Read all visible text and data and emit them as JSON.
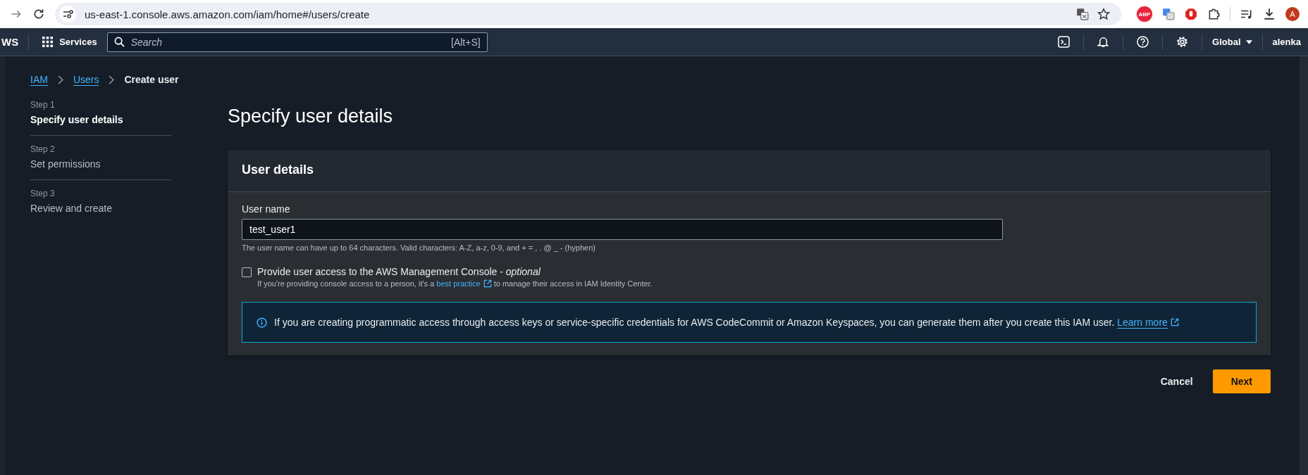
{
  "browser": {
    "url": "us-east-1.console.aws.amazon.com/iam/home#/users/create",
    "extension_badge": "ABP",
    "profile_initial": "A"
  },
  "top_nav": {
    "logo": "WS",
    "services": "Services",
    "search": {
      "placeholder": "Search",
      "shortcut": "[Alt+S]"
    },
    "region": "Global",
    "user": "alenka"
  },
  "breadcrumb": [
    {
      "label": "IAM",
      "kind": "link"
    },
    {
      "label": "Users",
      "kind": "link"
    },
    {
      "label": "Create user",
      "kind": "current"
    }
  ],
  "steps": [
    {
      "step": "Step 1",
      "title": "Specify user details",
      "selected": true
    },
    {
      "step": "Step 2",
      "title": "Set permissions",
      "selected": false
    },
    {
      "step": "Step 3",
      "title": "Review and create",
      "selected": false
    }
  ],
  "page_title": "Specify user details",
  "card": {
    "title": "User details",
    "user_name": {
      "label": "User name",
      "value": "test_user1",
      "hint": "The user name can have up to 64 characters. Valid characters: A-Z, a-z, 0-9, and + = , . @ _ - (hyphen)"
    },
    "console_access": {
      "label": "Provide user access to the AWS Management Console - *optional*",
      "checked": false,
      "description_before": "If you're providing console access to a person, it's a ",
      "link": "best practice",
      "description_after": " to manage their access in IAM Identity Center."
    },
    "info": {
      "text": "If you are creating programmatic access through access keys or service-specific credentials for AWS CodeCommit or Amazon Keyspaces, you can generate them after you create this IAM user.",
      "link": "Learn more"
    }
  },
  "buttons": [
    {
      "label": "Cancel",
      "kind": "link"
    },
    {
      "label": "Next",
      "kind": "primary"
    }
  ]
}
